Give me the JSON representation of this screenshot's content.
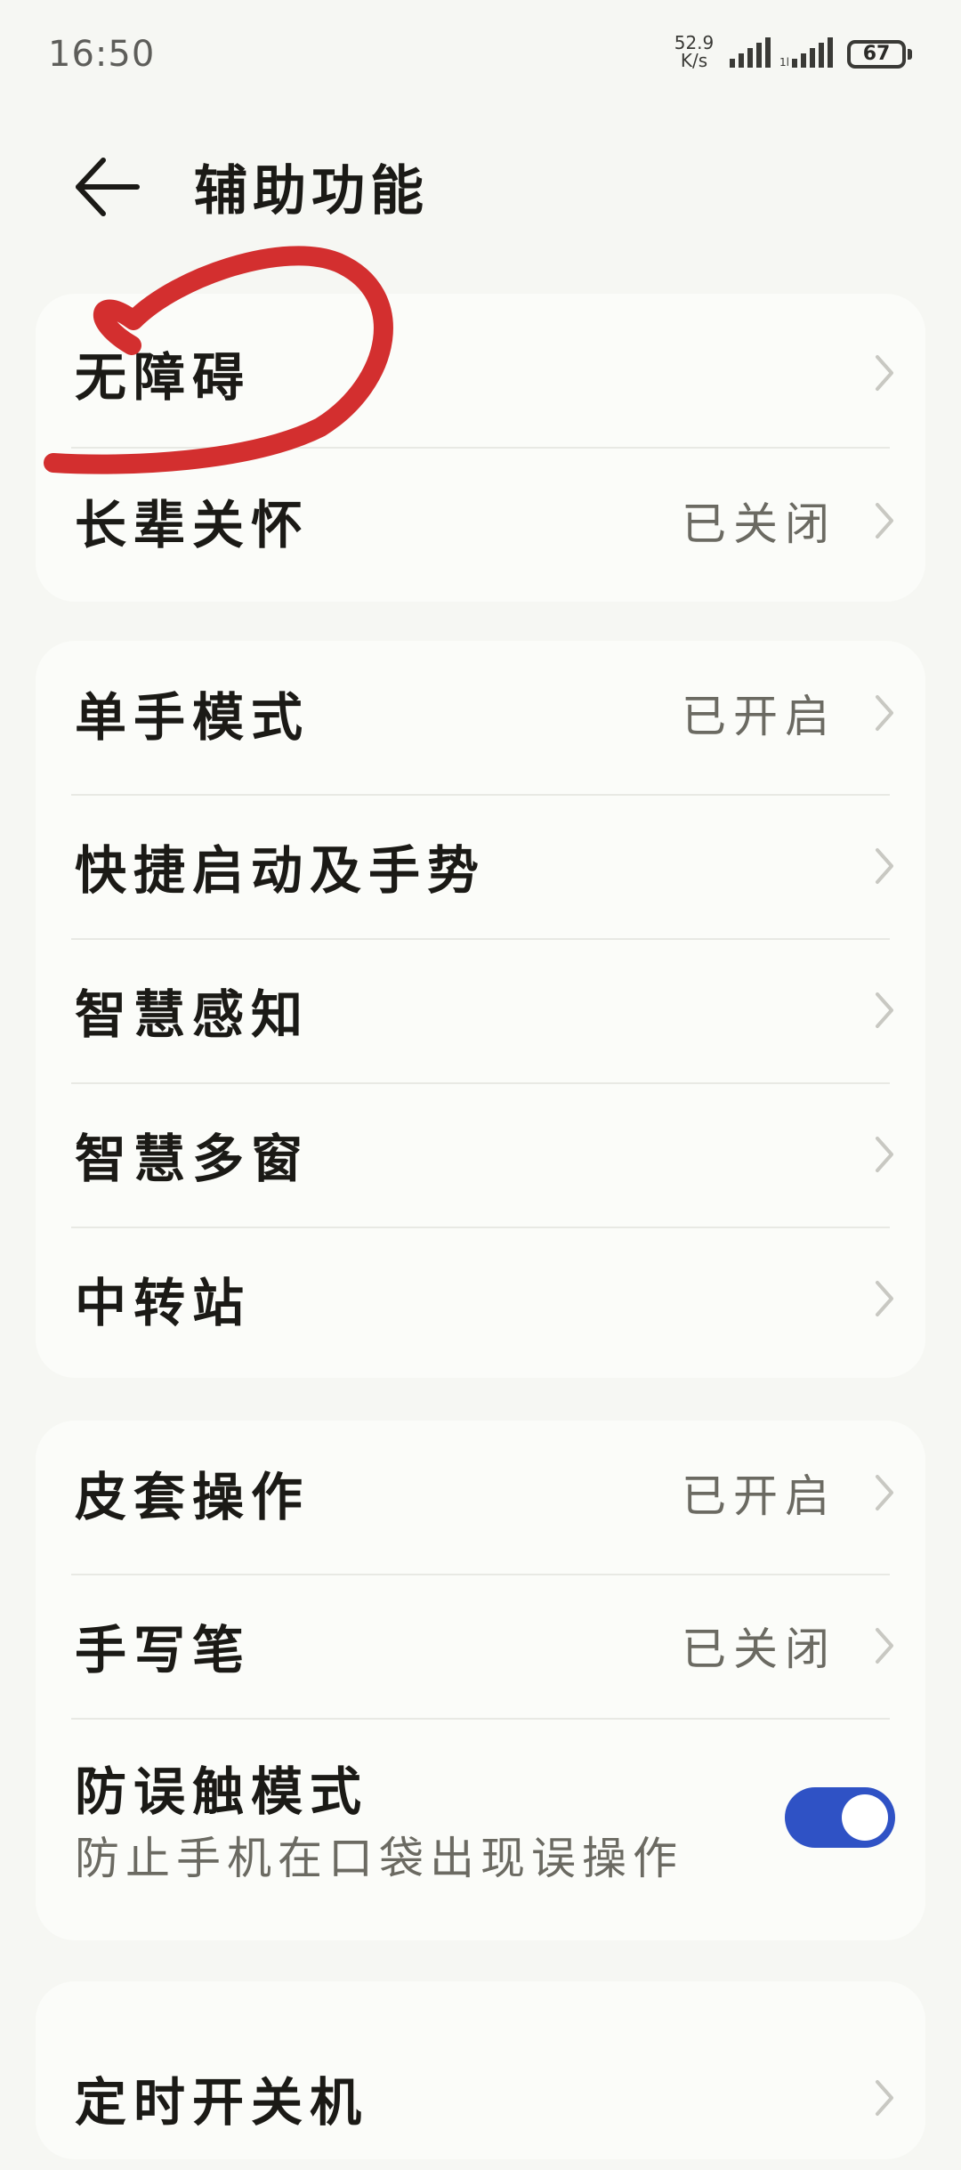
{
  "status_bar": {
    "time": "16:50",
    "net_speed_value": "52.9",
    "net_speed_unit": "K/s",
    "battery": "67"
  },
  "header": {
    "title": "辅助功能",
    "back_icon": "arrow-left-icon"
  },
  "groups": [
    {
      "items": [
        {
          "label": "无障碍",
          "value": ""
        },
        {
          "label": "长辈关怀",
          "value": "已关闭"
        }
      ]
    },
    {
      "items": [
        {
          "label": "单手模式",
          "value": "已开启"
        },
        {
          "label": "快捷启动及手势",
          "value": ""
        },
        {
          "label": "智慧感知",
          "value": ""
        },
        {
          "label": "智慧多窗",
          "value": ""
        },
        {
          "label": "中转站",
          "value": ""
        }
      ]
    },
    {
      "items": [
        {
          "label": "皮套操作",
          "value": "已开启"
        },
        {
          "label": "手写笔",
          "value": "已关闭"
        }
      ],
      "toggle_item": {
        "label": "防误触模式",
        "description": "防止手机在口袋出现误操作",
        "enabled": true
      }
    },
    {
      "items": [
        {
          "label": "定时开关机",
          "value": ""
        }
      ]
    }
  ],
  "colors": {
    "background": "#f6f7f3",
    "card": "#fbfcf9",
    "toggle_on": "#2f52c5",
    "annotation_red": "#d32f2f",
    "secondary_text": "#6b6a62"
  },
  "icons": {
    "chevron": "chevron-right-icon",
    "wifi_signal": "signal-icon",
    "cell_signal": "signal-icon",
    "battery": "battery-icon"
  }
}
